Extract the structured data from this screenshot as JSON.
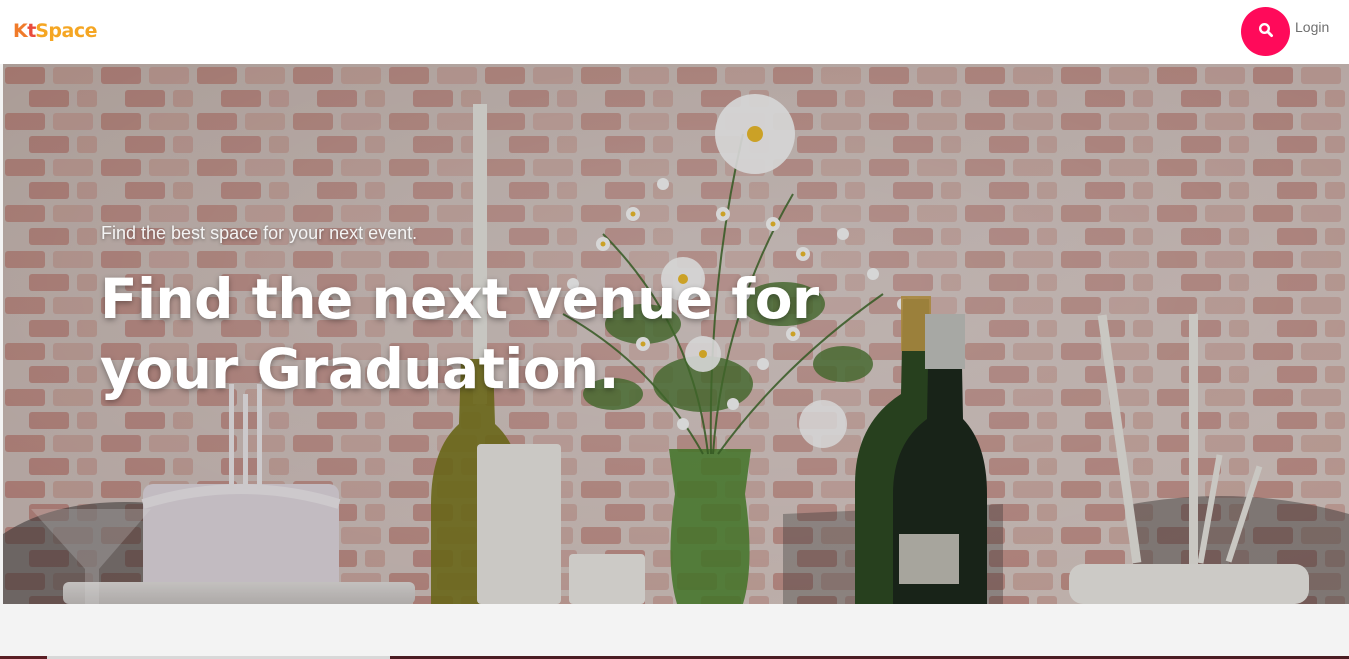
{
  "header": {
    "logo": {
      "part1": "K",
      "part2": "t",
      "part3": "Space"
    },
    "search_icon": "search-icon",
    "login_label": "Login"
  },
  "hero": {
    "tagline": "Find the best space for your next event.",
    "title": "Find the next venue for your Graduation.",
    "background": "brick wall with flowers, bottles, candles and cakes"
  },
  "colors": {
    "logo_orange": "#f5a623",
    "accent_pink": "#ff0a5a",
    "login_gray": "#6f6f6f"
  }
}
